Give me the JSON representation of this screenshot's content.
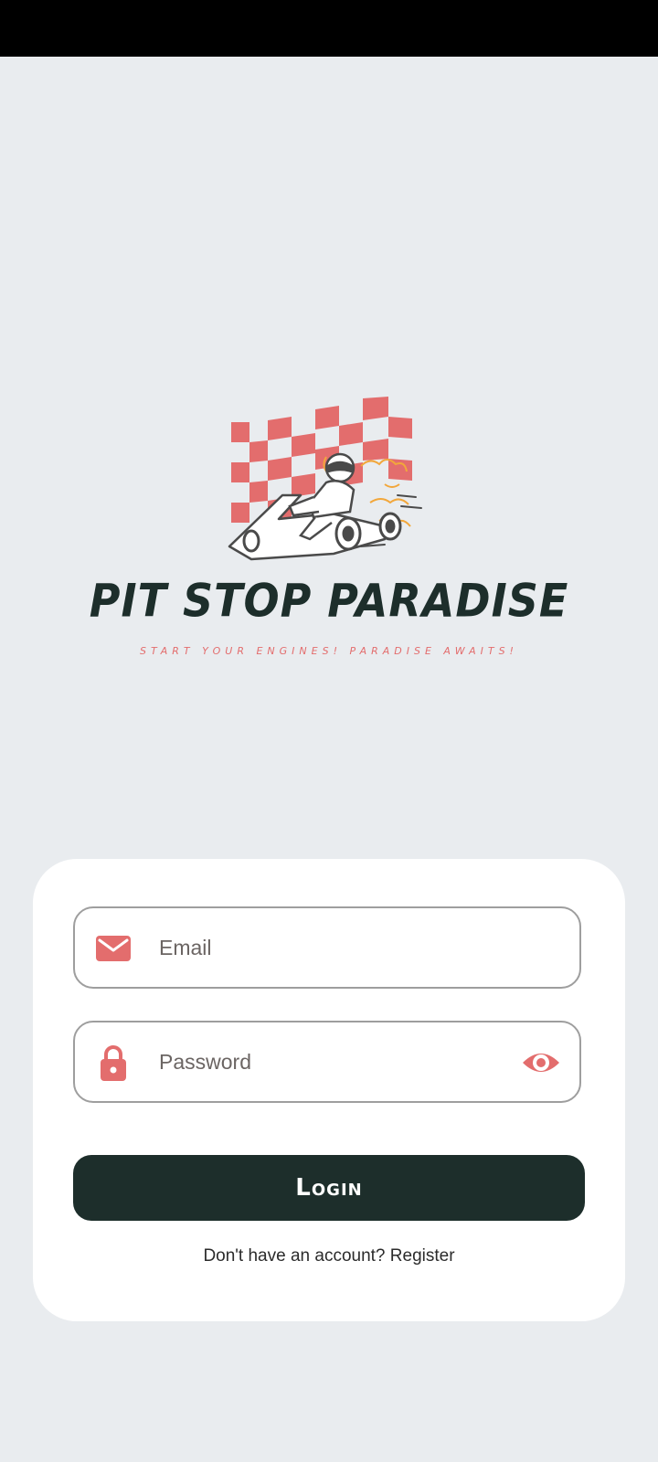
{
  "status_bar": {},
  "brand": {
    "title": "PIT STOP PARADISE",
    "tagline": "START YOUR ENGINES! PARADISE AWAITS!",
    "flag_color": "#e36d6d",
    "title_color": "#1d2e2b"
  },
  "login_form": {
    "email": {
      "placeholder": "Email",
      "value": "",
      "icon": "mail-icon"
    },
    "password": {
      "placeholder": "Password",
      "value": "",
      "icon": "lock-icon",
      "toggle_icon": "eye-icon"
    },
    "login_label": "Login",
    "register_prompt": "Don't have an account?",
    "register_link": "Register"
  },
  "colors": {
    "accent": "#e36d6d",
    "primary": "#1d2e2b",
    "background": "#e9ecef",
    "card": "#ffffff"
  }
}
